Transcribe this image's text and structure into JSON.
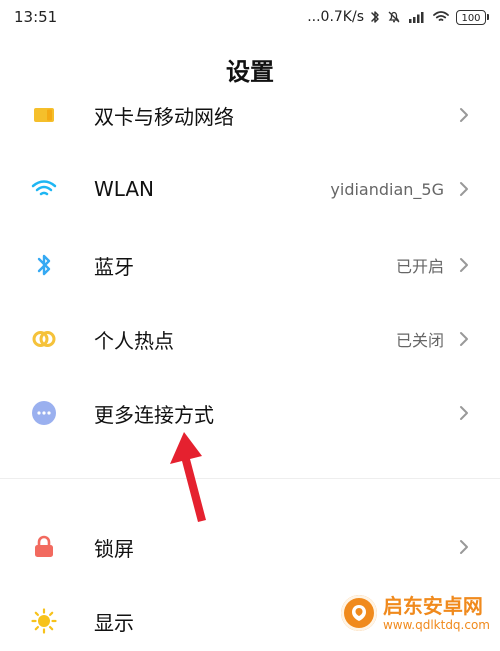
{
  "status_bar": {
    "time": "13:51",
    "speed": "...0.7K/s",
    "battery": "100",
    "icons": [
      "bluetooth-icon",
      "do-not-disturb-icon",
      "signal-icon",
      "wifi-icon",
      "battery-icon"
    ]
  },
  "header": {
    "title": "设置"
  },
  "settings": {
    "items": [
      {
        "label": "双卡与移动网络",
        "value": "",
        "icon": "sim-card-icon",
        "color": "#f5bf2b"
      },
      {
        "label": "WLAN",
        "value": "yidiandian_5G",
        "icon": "wifi-icon",
        "color": "#1eb6f3"
      },
      {
        "label": "蓝牙",
        "value": "已开启",
        "icon": "bluetooth-icon",
        "color": "#35a9f3"
      },
      {
        "label": "个人热点",
        "value": "已关闭",
        "icon": "hotspot-icon",
        "color": "#f5c23a"
      },
      {
        "label": "更多连接方式",
        "value": "",
        "icon": "more-connections-icon",
        "color": "#9ab0ef"
      },
      {
        "label": "锁屏",
        "value": "",
        "icon": "lock-icon",
        "color": "#f26a5f"
      },
      {
        "label": "显示",
        "value": "",
        "icon": "display-brightness-icon",
        "color": "#f7c21b"
      }
    ]
  },
  "watermark": {
    "main": "启东安卓网",
    "sub": "www.qdlktdq.com",
    "icon": "watermark-logo-icon",
    "color": "#f08a1d"
  },
  "annotation": {
    "arrow_color": "#e5212f"
  }
}
